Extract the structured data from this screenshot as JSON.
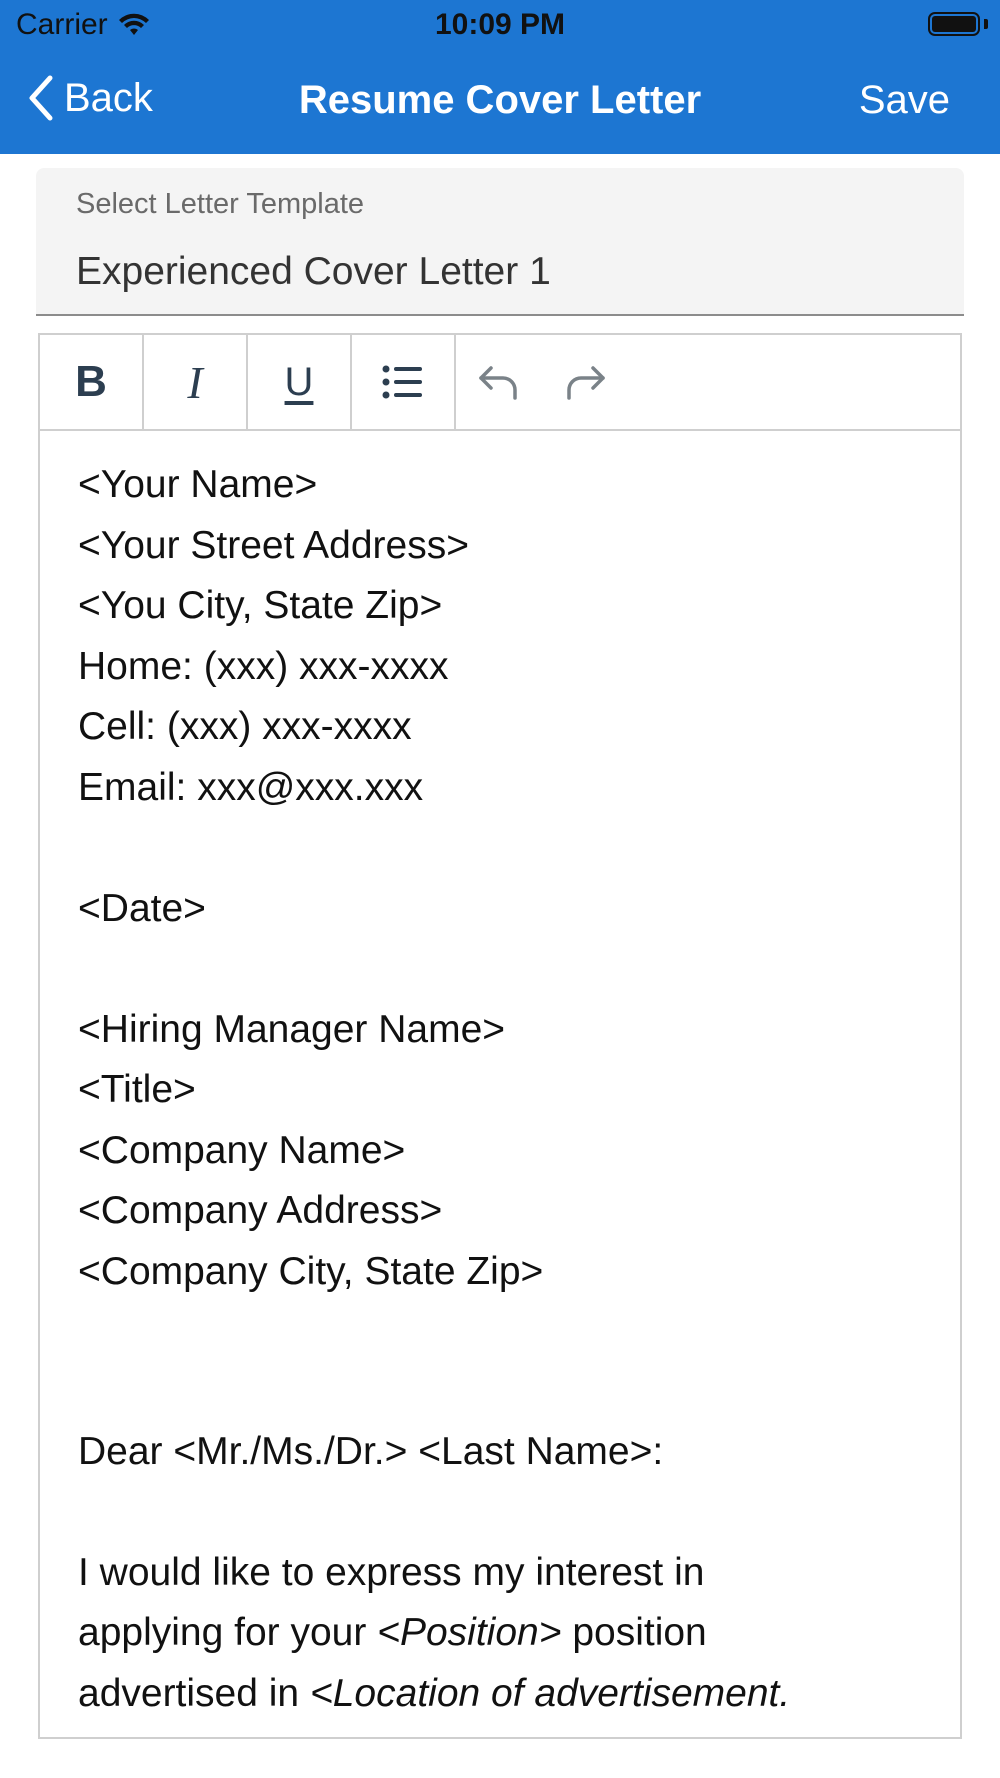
{
  "status_bar": {
    "carrier": "Carrier",
    "time": "10:09 PM"
  },
  "nav": {
    "back_label": "Back",
    "title": "Resume Cover Letter",
    "save_label": "Save"
  },
  "template": {
    "label": "Select Letter Template",
    "value": "Experienced Cover Letter 1"
  },
  "toolbar": [
    "bold-icon",
    "italic-icon",
    "underline-icon",
    "list-icon",
    "undo-icon",
    "redo-icon"
  ],
  "letter": {
    "sender_name": "<Your Name>",
    "sender_street": "<Your Street Address>",
    "sender_city": "<You City, State Zip>",
    "home_phone": "Home: (xxx) xxx-xxxx",
    "cell_phone": "Cell: (xxx) xxx-xxxx",
    "email": "Email: xxx@xxx.xxx",
    "date": "<Date>",
    "hiring_manager": "<Hiring Manager Name>",
    "recipient_title": "<Title>",
    "company_name": "<Company Name>",
    "company_address": "<Company Address>",
    "company_city": "<Company City, State Zip>",
    "salutation": "Dear <Mr./Ms./Dr.> <Last Name>:",
    "body_line1": "I would like to express my interest in",
    "body_line2_a": "applying for your ",
    "body_line2_b": "<Position>",
    "body_line2_c": " position",
    "body_line3_a": "advertised in ",
    "body_line3_b": "<Location of advertisement."
  }
}
